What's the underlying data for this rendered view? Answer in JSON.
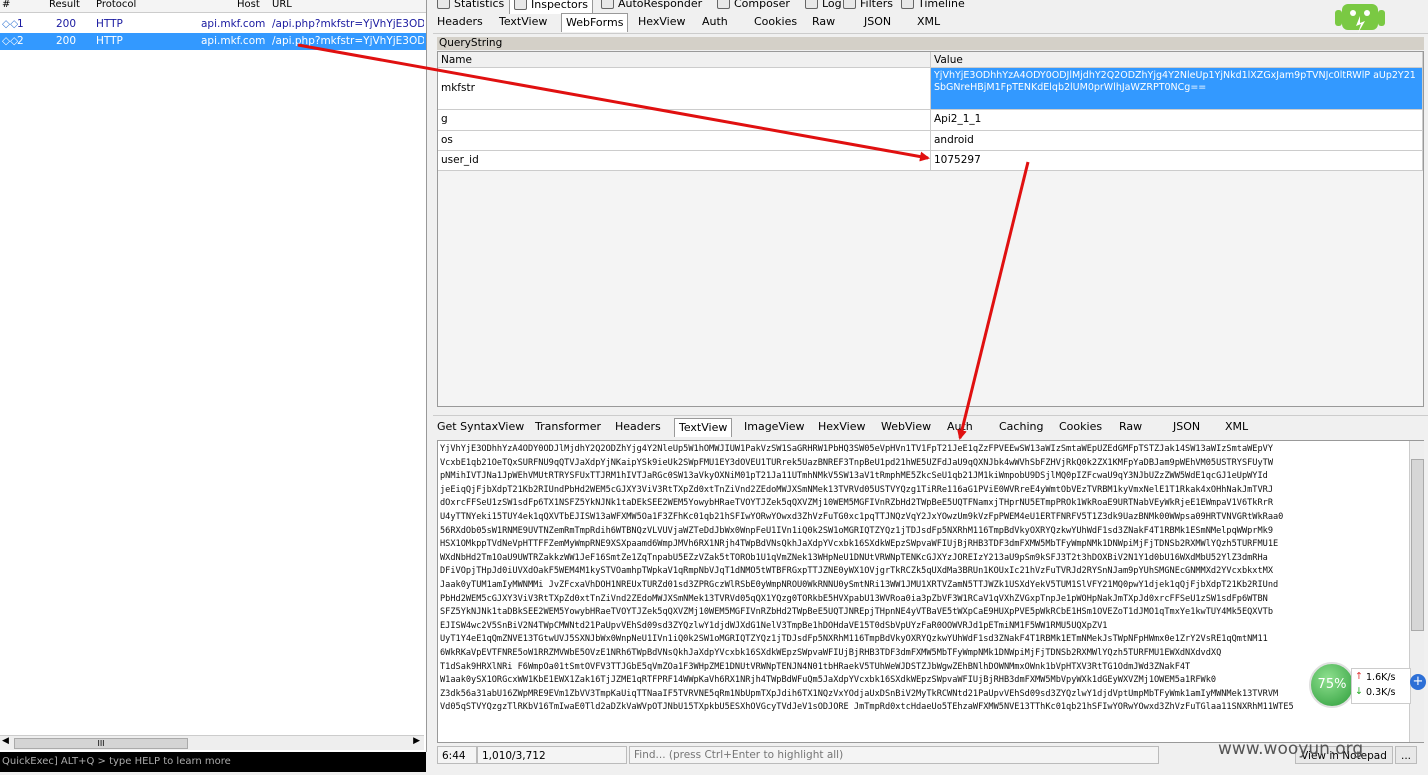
{
  "sessions": {
    "columns": [
      "#",
      "Result",
      "Protocol",
      "Host",
      "URL"
    ],
    "rows": [
      {
        "id": "1",
        "result": "200",
        "protocol": "HTTP",
        "host": "api.mkf.com",
        "url": "/api.php?mkfstr=YjVhYjE3ODhh"
      },
      {
        "id": "2",
        "result": "200",
        "protocol": "HTTP",
        "host": "api.mkf.com",
        "url": "/api.php?mkfstr=YjVhYjE3ODhh"
      }
    ],
    "scroll_thumb": "III"
  },
  "quickexec": "QuickExec] ALT+Q > type HELP to learn more",
  "top_tabs": [
    "Statistics",
    "Inspectors",
    "AutoResponder",
    "Composer",
    "Log",
    "Filters",
    "Timeline"
  ],
  "request_tabs": [
    "Headers",
    "TextView",
    "WebForms",
    "HexView",
    "Auth",
    "Cookies",
    "Raw",
    "JSON",
    "XML"
  ],
  "querystring": {
    "title": "QueryString",
    "columns": [
      "Name",
      "Value"
    ],
    "rows": [
      {
        "name": "mkfstr",
        "value": "YjVhYjE3ODhhYzA4ODY0ODJlMjdhY2Q2ODZhYjg4Y2NleUp1YjNkd1lXZGxJam9pTVNJc0ltRWlP aUp2Y21SbGNreHBjM1FpTENKdElqb2lUM0prWlhJaWZRPT0NCg=="
      },
      {
        "name": "g",
        "value": "Api2_1_1"
      },
      {
        "name": "os",
        "value": "android"
      },
      {
        "name": "user_id",
        "value": "1075297"
      }
    ]
  },
  "response_tabs": [
    "Get SyntaxView",
    "Transformer",
    "Headers",
    "TextView",
    "ImageView",
    "HexView",
    "WebView",
    "Auth",
    "Caching",
    "Cookies",
    "Raw",
    "JSON",
    "XML"
  ],
  "response_text": [
    "YjVhYjE3ODhhYzA4ODY0ODJlMjdhY2Q2ODZhYjg4Y2NleUp5W1hOMWJIUW1PakVzSW1SaGRHRW1PbHQ3SW05eVpHVn1TV1FpT21JeE1qZzFPVEEwSW13aWIzSmtaWEpUZEdGMFpTSTZJak14SW13aWIzSmtaWEpVY",
    "VcxbE1qb21OeTQxSURFNU9qQTVJaXdpYjNKaipYSk9ieUk2SWpFMU1EY3dOVEU1TURrek5UazBNREF3TnpBeU1pd21hWE5UZFdJaU9qQXNJbk4wWVhSbFZHVjRkQ0k2ZX1KMFpYaDBJam9pWEhVM05USTRYSFUyTW",
    "pNMihIVTJNa1JpWEhVMUtRTRYSFUxTTJRM1hIVTJaRGc0SW13aVkyOXNiM01pT21Ja11UTmhNMkV5SW13aV1tRmphME5ZkcSeU1qb21JM1kiWmpobU9DSjlMQ0pIZFcwaU9qY3NJbUZzZWW5WdE1qcGJ1eUpWYId",
    "jeEiqQjFjbXdpT21Kb2RIUndPbHd2WEM5cGJXY3ViV3RtTXpZd0xtTnZiVnd2ZEdoMWJXSmNMek13TVRVd05USTVYQzg1TiRRe116aG1PViE0WVRreE4yWmtObVEzTVRBM1kyVmxNelE1T1Rkak4xOHhNakJmTVRJ",
    "dOxrcFFSeU1zSW1sdFp6TX1NSFZ5YkNJNk1taDEkSEE2WEM5YowybHRaeTVOYTJZek5qQXVZMj10WEM5MGFIVnRZbHd2TWpBeE5UQTFNamxjTHprNU5ETmpPROk1WkRoaE9URTNabVEyWkRjeE1EWmpaV1V6TkRrR",
    "U4yTTNYeki15TUY4ek1qQXVTbEJISW13aWFXMW5Oa1F3ZFhKc01qb21hSFIwYORwYOwxd3ZhVzFuTG0xc1pqTTJNQzVqY2JxYOwzUm9kVzFpPWEM4eU1ERTFNRFV5T1Z3dk9UazBNMk00WWpsa09HRTVNVGRtWkRaa0",
    "56RXdOb05sW1RNME9UVTNZemRmTmpRdih6WTBNQzVLVUVjaWZTeDdJbWx0WnpFeU1IVn1iQ0k2SW1oMGRIQTZYQz1jTDJsdFp5NXRhM116TmpBdVkyOXRYQzkwYUhWdF1sd3ZNakF4T1RBMk1ESmNMelpqWWprMk9",
    "HSX1OMkppTVdNeVpHTTFFZemMyWmpRNE9XSXpaamd6WmpJMVh6RX1NRjh4TWpBdVNsQkhJaXdpYVcxbk16SXdkWEpzSWpvaWFIUjBjRHB3TDF3dmFXMW5MbTFyWmpNMk1DNWpiMjFjTDNSb2RXMWlYQzh5TURFMU1E",
    "WXdNbHd2Tm1OaU9UWTRZakkzWW1JeF16SmtZe1ZqTnpabU5EZzVZak5tTOROb1U1qVmZNek13WHpNeU1DNUtVRWNpTENKcGJXYzJOREIzY213aU9pSm9kSFJ3T2t3hDOXBiV2N1Y1d0bU16WXdMbU52YlZ3dmRHa",
    "DFiVOpjTHpJd0iUVXdOakF5WEM4M1kySTVOamhpTWpkaV1qRmpNbVJqT1dNMO5tWTBFRGxpTTJZNE0yWX1OVjgrTkRCZk5qUXdMa3BRUn1KOUxIc21hVzFuTVRJd2RYSnNJam9pYUhSMGNEcGNMMXd2YVcxbkxtMX",
    "Jaak0yTUM1amIyMWNMMi JvZFcxaVhDOH1NREUxTURZd01sd3ZPRGczWlRSbE0yWmpNROU0WkRNNU0ySmtNRi13WW1JMU1XRTVZamN5TTJWZk1USXdYekV5TUM1SlVFY21MQ0pwY1djek1qQjFjbXdpT21Kb2RIUnd",
    "PbHd2WEM5cGJXY3ViV3RtTXpZd0xtTnZiVnd2ZEdoMWJXSmNMek13TVRVd05qQX1YQzg0TORkbE5HVXpabU13WVRoa0ia3pZbVF3W1RCaV1qVXhZVGxpTnpJe1pWOHpNakJmTXpJd0xrcFFSeU1zSW1sdFp6WTBN",
    "SFZ5YkNJNk1taDBkSEE2WEM5YowybHRaeTVOYTJZek5qQXVZMj10WEM5MGFIVnRZbHd2TWpBeE5UQTJNREpjTHpnNE4yVTBaVE5tWXpCaE9HUXpPVE5pWkRCbE1HSm1OVEZoT1dJMO1qTmxYe1kwTUY4Mk5EQXVTb",
    "EJISW4wc2V5SnBiV2N4TWpCMWNtd21PaUpvVEhSd09sd3ZYQzlwY1djdWJXdG1NelV3TmpBe1hDOHdaVE15T0dSbVpUYzFaR0OOWVRJd1pETmiNM1F5WW1RMU5UQXpZV1",
    "UyT1Y4eE1qQmZNVE13TGtwUVJ5SXNJbWx0WnpNeU1IVn1iQ0k2SW1oMGRIQTZYQz1jTDJsdFp5NXRhM116TmpBdVkyOXRYQzkwYUhWdF1sd3ZNakF4T1RBMk1ETmNMekJsTWpNFpHWmx0e1ZrY2VsRE1qQmtNM11",
    "6WkRKaVpEVTFNRE5oW1RRZMVWbE5OVzE1NRh6TWpBdVNsQkhJaXdpYVcxbk16SXdkWEpzSWpvaWFIUjBjRHB3TDF3dmFXMW5MbTFyWmpNMk1DNWpiMjFjTDNSb2RXMWlYQzh5TURFMU1EWXdNXdvdXQ",
    "T1dSak9HRXlNRi F6WmpOa01tSmtOVFV3TTJGbE5qVmZOa1F3WHpZME1DNUtVRWNpTENJN4N01tbHRaekV5TUhWeWJDSTZJbWgwZEhBNlhDOWNMmxOWnk1bVpHTXV3RtTG1OdmJWd3ZNakF4T",
    "W1aak0ySX1ORGcxWW1KbE1EWX1Zak16TjJZME1qRTFPRF14WWpKaVh6RX1NRjh4TWpBdWFuQm5JaXdpYVcxbk16SXdkWEpzSWpvaWFIUjBjRHB3dmFXMW5MbVpyWXk1dGEyWXVZMj1OWEM5a1RFWk0",
    "Z3dk56a31abU16ZWpMRE9EVm1ZbVV3TmpKaUiqTTNaaIF5TVRVNE5qRm1NbUpmTXpJdih6TX1NQzVxYOdjaUxDSnBiV2MyTkRCWNtd21PaUpvVEhSd09sd3ZYQzlwY1djdVptUmpMbTFyWmk1amIyMWNMek13TVRVM",
    "Vd05qSTVYQzgzTlRKbV16TmIwaE0Tld2aDZkVaWVpOTJNbU15TXpkbU5ESXhOVGcyTVdJeV1sODJORE JmTmpRd0xtcHdaeUo5TEhzaWFXMW5NVE13TThKc01qb21hSFIwYORwYOwxd3ZhVzFuTGlaa11SNXRhM11WTE5"
  ],
  "status": {
    "position": "6:44",
    "selection": "1,010/3,712",
    "find_placeholder": "Find... (press Ctrl+Enter to highlight all)",
    "notepad_button": "View in Notepad",
    "more_button": "..."
  },
  "widget": {
    "percent": "75%",
    "upload": "1.6K/s",
    "download": "0.3K/s"
  },
  "watermark": "www.wooyun.org",
  "colors": {
    "selection": "#3399ff",
    "arrow": "#e01010",
    "session_text": "#1a1aa0"
  }
}
